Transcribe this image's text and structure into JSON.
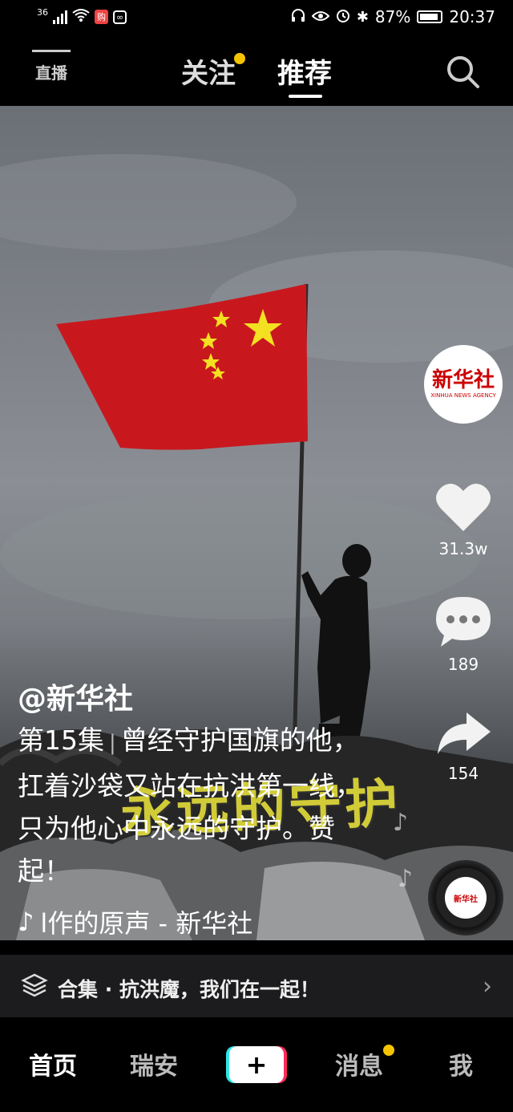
{
  "status_bar": {
    "network": "36",
    "battery": "87%",
    "time": "20:37"
  },
  "top_bar": {
    "live_label": "直播",
    "tabs": [
      {
        "label": "关注",
        "has_dot": true
      },
      {
        "label": "推荐",
        "active": true
      }
    ]
  },
  "video": {
    "overlay_text": "永远的守护"
  },
  "right_actions": {
    "avatar_logo": "新华社",
    "avatar_logo_en": "XINHUA NEWS AGENCY",
    "like_count": "31.3w",
    "comment_count": "189",
    "share_count": "154"
  },
  "caption": {
    "author": "@新华社",
    "episode": "第15集",
    "text": "曾经守护国旗的他，扛着沙袋又站在抗洪第一线，只为他心中永远的守护。赞起！",
    "music": "l作的原声 - 新华社"
  },
  "collection": {
    "label": "合集 · 抗洪魔，我们在一起！"
  },
  "bottom_nav": {
    "items": [
      "首页",
      "瑞安",
      "+",
      "消息",
      "我"
    ]
  },
  "colors": {
    "accent_dot": "#f5c400",
    "flag_red": "#c8181e",
    "star_yellow": "#f3e021"
  }
}
